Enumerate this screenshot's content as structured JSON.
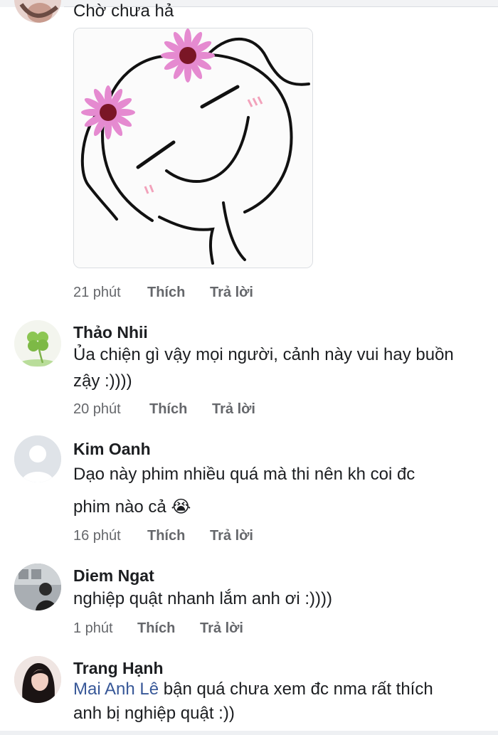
{
  "comments": [
    {
      "name": "",
      "lines": [
        "Chờ chưa hả"
      ],
      "time": "21 phút",
      "like": "Thích",
      "reply": "Trả lời",
      "sticker": "smiling-face-with-flowers-sticker"
    },
    {
      "name": "Thảo Nhii",
      "lines": [
        "Ủa chiện gì vậy mọi người, cảnh này vui hay buồn",
        "zậy :))))"
      ],
      "time": "20 phút",
      "like": "Thích",
      "reply": "Trả lời"
    },
    {
      "name": "Kim Oanh",
      "lines": [
        "Dạo này phim nhiều quá mà thi nên kh coi đc",
        "phim nào cả"
      ],
      "emoji": "😭",
      "time": "16 phút",
      "like": "Thích",
      "reply": "Trả lời"
    },
    {
      "name": "Diem Ngat",
      "lines": [
        "nghiệp quật nhanh lắm anh ơi :))))"
      ],
      "time": "1 phút",
      "like": "Thích",
      "reply": "Trả lời"
    },
    {
      "name": "Trang Hạnh",
      "mention": "Mai Anh Lê",
      "lines": [
        " bận quá chưa xem đc nma rất thích",
        "anh bị nghiệp quật :))"
      ]
    }
  ],
  "colors": {
    "name": "#1c1e21",
    "meta": "#65676b",
    "mention": "#385898",
    "flower": "#e58ad0"
  }
}
